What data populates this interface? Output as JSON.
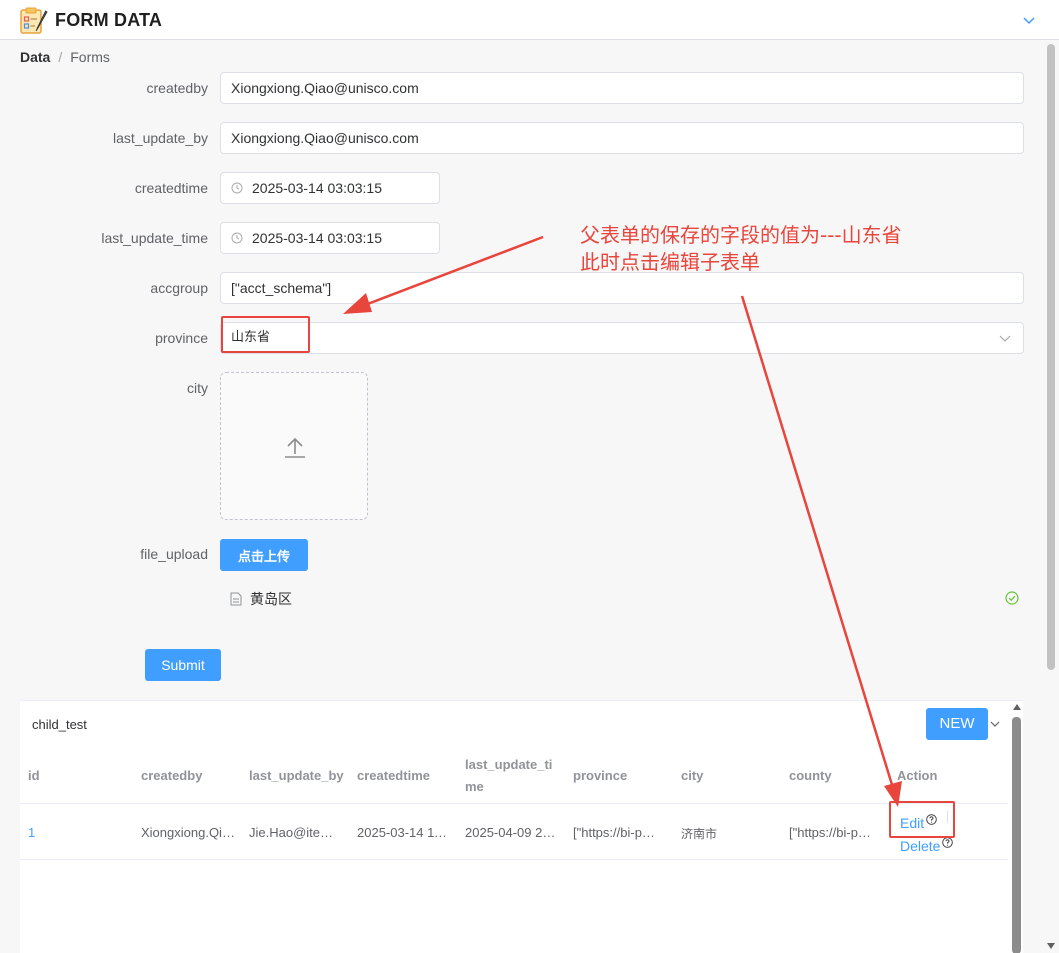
{
  "header": {
    "title": "FORM DATA",
    "icon": "clipboard-pencil-icon"
  },
  "breadcrumb": {
    "root": "Data",
    "separator": "/",
    "current": "Forms"
  },
  "form": {
    "createdby": {
      "label": "createdby",
      "value": "Xiongxiong.Qiao@unisco.com"
    },
    "last_update_by": {
      "label": "last_update_by",
      "value": "Xiongxiong.Qiao@unisco.com"
    },
    "createdtime": {
      "label": "createdtime",
      "value": "2025-03-14 03:03:15"
    },
    "last_update_time": {
      "label": "last_update_time",
      "value": "2025-03-14 03:03:15"
    },
    "accgroup": {
      "label": "accgroup",
      "value": "[\"acct_schema\"]"
    },
    "province": {
      "label": "province",
      "value": "山东省"
    },
    "city": {
      "label": "city"
    },
    "file_upload": {
      "label": "file_upload",
      "button_label": "点击上传",
      "file_name": "黄岛区"
    },
    "submit_label": "Submit"
  },
  "annotation": {
    "line1": "父表单的保存的字段的值为---山东省",
    "line2": "此时点击编辑子表单",
    "color": "#e8453c"
  },
  "child_table": {
    "title": "child_test",
    "new_label": "NEW",
    "columns": {
      "id": "id",
      "createdby": "createdby",
      "last_update_by": "last_update_by",
      "createdtime": "createdtime",
      "last_update_time": "last_update_ti me",
      "province": "province",
      "city": "city",
      "county": "county",
      "action": "Action"
    },
    "rows": [
      {
        "id": "1",
        "createdby": "Xiongxiong.Qi…",
        "last_update_by": "Jie.Hao@ite…",
        "createdtime": "2025-03-14 11…",
        "last_update_time": "2025-04-09 23…",
        "province": "[\"https://bi-p…",
        "city": "济南市",
        "county": "[\"https://bi-p…",
        "edit_label": "Edit",
        "delete_label": "Delete"
      }
    ]
  },
  "colors": {
    "primary": "#409eff",
    "annotation": "#e8453c",
    "success": "#67c23a"
  }
}
